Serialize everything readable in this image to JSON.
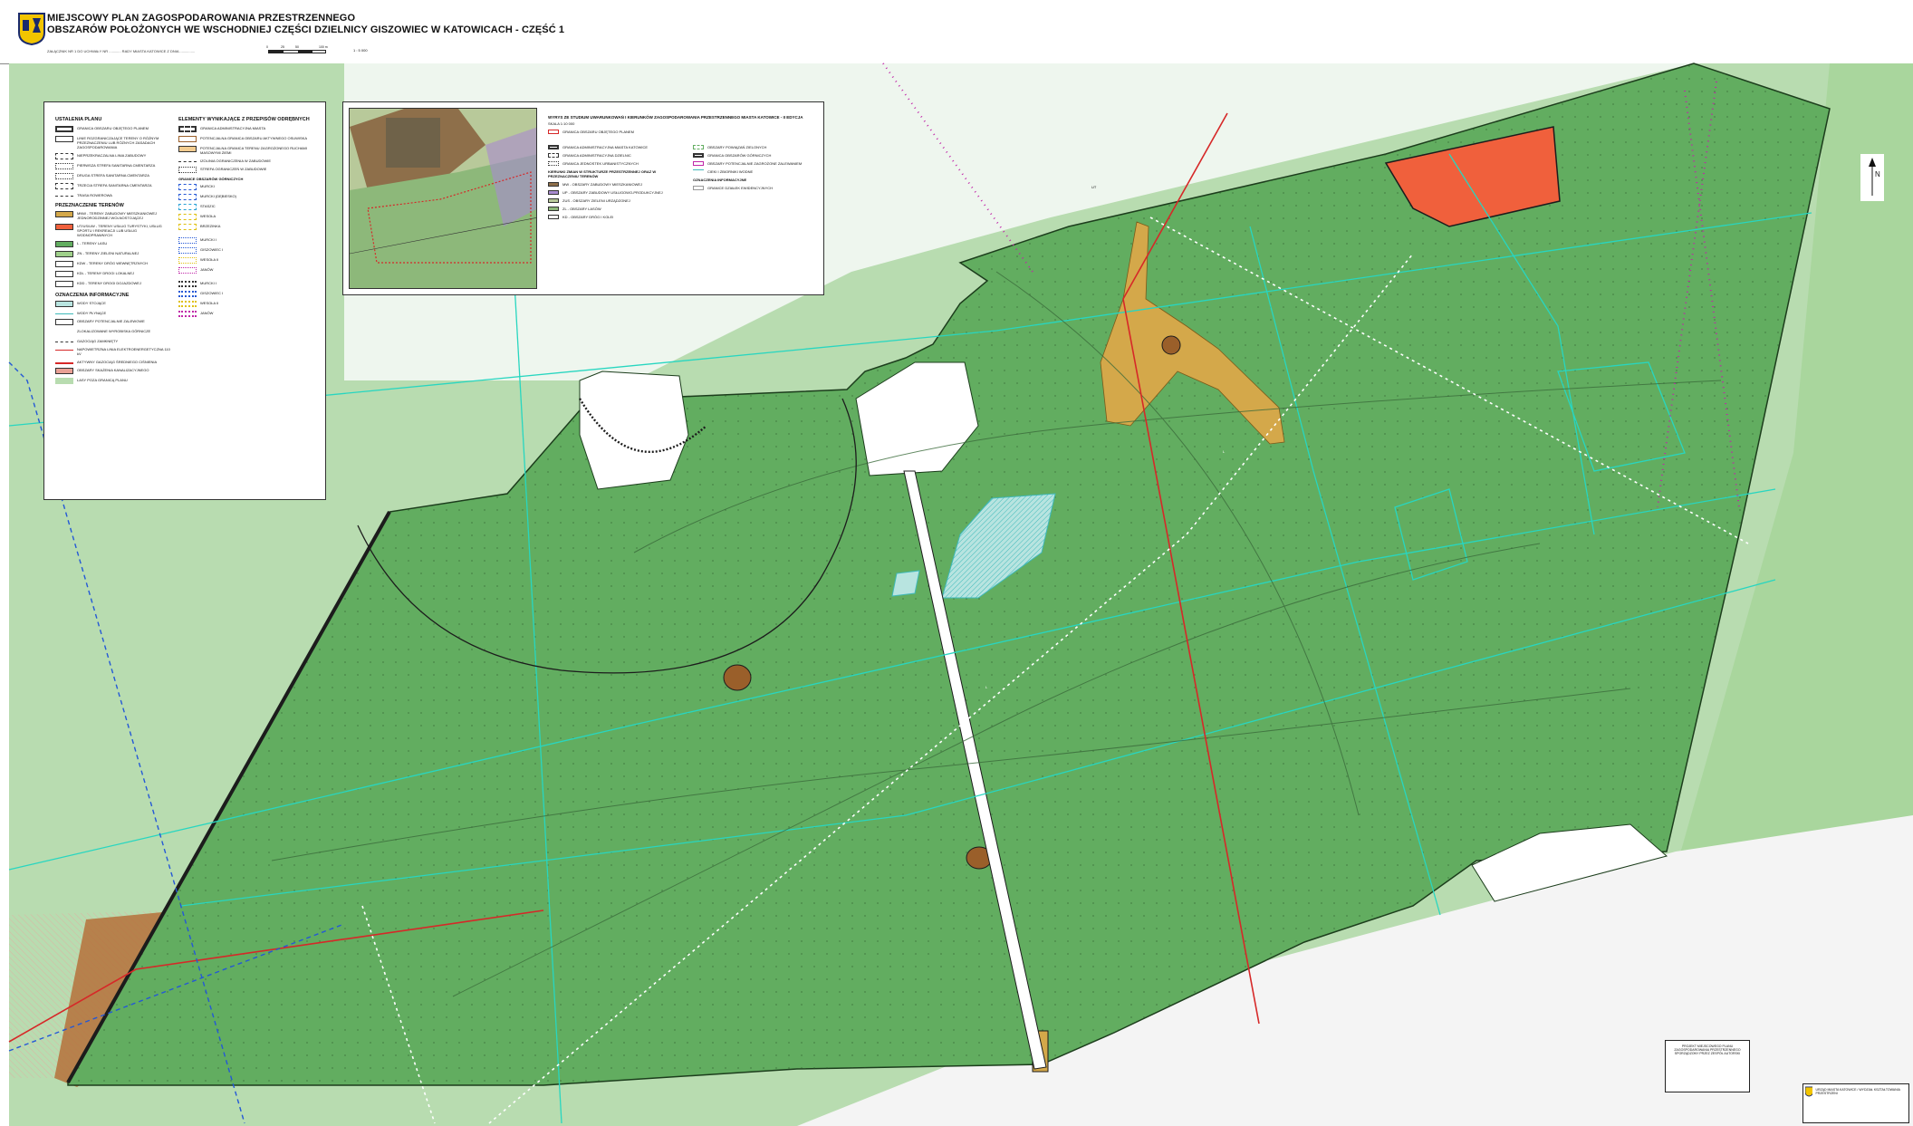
{
  "header": {
    "title_line1": "MIEJSCOWY PLAN ZAGOSPODAROWANIA PRZESTRZENNEGO",
    "title_line2": "OBSZARÓW POŁOŻONYCH WE WSCHODNIEJ CZĘŚCI DZIELNICY GISZOWIEC W KATOWICACH - CZĘŚĆ 1",
    "subline": "ZAŁĄCZNIK NR 1 DO UCHWAŁY NR ............ RADY MIASTA KATOWICE Z DNIA ...............",
    "scale_ticks": [
      "0",
      "25",
      "50",
      "100 m"
    ],
    "scale": "1 : 5 000"
  },
  "legend": {
    "section_plan": "USTALENIA PLANU",
    "plan_items": [
      "GRANICA OBSZARU OBJĘTEGO PLANEM",
      "LINIE ROZGRANICZAJĄCE TERENY O RÓŻNYM PRZEZNACZENIU LUB RÓŻNYCH ZASADACH ZAGOSPODAROWANIA",
      "NIEPRZEKRACZALNA LINIA ZABUDOWY",
      "PIERWSZA STREFA SANITARNA CMENTARZA",
      "DRUGA STREFA SANITARNA CMENTARZA",
      "TRZECIA STREFA SANITARNA CMENTARZA",
      "TRASA ROWEROWA"
    ],
    "section_uses": "PRZEZNACZENIE TERENÓW",
    "use_items": [
      {
        "label": "MNW - TERENY ZABUDOWY MIESZKANIOWEJ JEDNORODZINNEJ WOLNOSTOJĄCEJ",
        "color": "#d4a84a"
      },
      {
        "label": "UT/US/UW - TERENY USŁUG TURYSTYKI, USŁUG SPORTU I REKREACJI LUB USŁUG WODNOPRAWNYCH",
        "color": "#f0603c"
      },
      {
        "label": "L - TERENY LASU",
        "color": "#62ad60"
      },
      {
        "label": "ZN - TERENY ZIELENI NATURALNEJ",
        "color": "#9fd08a"
      },
      {
        "label": "KDW - TERENY DRÓG WEWNĘTRZNYCH",
        "color": "#ffffff"
      },
      {
        "label": "KDL - TERENY DROGI LOKALNEJ",
        "color": "#ffffff"
      },
      {
        "label": "KDD - TERENY DROGI DOJAZDOWEJ",
        "color": "#ffffff"
      }
    ],
    "section_info": "OZNACZENIA INFORMACYJNE",
    "info_items": [
      "WODY STOJĄCE",
      "WODY PŁYNĄCE",
      "OBSZARY POTENCJALNIE ZALEWOWE",
      "ZLOKALIZOWANE WYROBISKA GÓRNICZE",
      "GAZOCIĄG ZAMKNIĘTY",
      "NAPOWIETRZNA LINIA ELEKTROENERGETYCZNA 110 kV",
      "AKTYWNY GAZOCIĄG ŚREDNIEGO CIŚNIENIA",
      "OBSZARY SKAŻENIA KANALIZACYJNEGO",
      "LASY POZA GRANICĄ PLANU"
    ],
    "section_elements": "ELEMENTY WYNIKAJĄCE Z PRZEPISÓW ODRĘBNYCH",
    "element_items": [
      "GRANICA ADMINISTRACYJNA MIASTA",
      "POTENCJALNA GRANICA OBSZARU AKTYWNEGO OSUWISKA",
      "POTENCJALNA GRANICA TERENU ZAGROŻONEGO RUCHAMI MASOWYMI ZIEMI",
      "IZOLINIA OGRANICZENIA W ZABUDOWIE",
      "STREFA OGRANICZEŃ W ZABUDOWIE",
      "GRANICE OBSZARÓW GÓRNICZYCH"
    ],
    "mining_areas": [
      "MURCKI",
      "MURCKI (DĘBIESKO)",
      "STASZIC",
      "WESOŁA",
      "BRZEZINKA"
    ],
    "mining_grounds": [
      "MURCKI I",
      "GISZOWIEC I",
      "WESOŁA II",
      "JANÓW"
    ],
    "terrain_grounds": [
      "MURCKI I",
      "GISZOWIEC I",
      "WESOŁA II",
      "JANÓW"
    ],
    "colors": {
      "forest": "#62ad60",
      "residential": "#d4a84a",
      "tourism": "#f0603c",
      "natural": "#9fd08a",
      "water": "#7dd3d3",
      "cyan_lines": "#28d6c0"
    }
  },
  "study": {
    "title": "WYRYS ZE STUDIUM UWARUNKOWAŃ I KIERUNKÓW ZAGOSPODAROWANIA PRZESTRZENNEGO MIASTA KATOWICE - II EDYCJA",
    "scale": "SKALA 1:10 000",
    "border_label": "GRANICA OBSZARU OBJĘTEGO PLANEM",
    "items_left": [
      "GRANICA ADMINISTRACYJNA MIASTA KATOWICE",
      "GRANICA ADMINISTRACYJNA DZIELNIC",
      "GRANICA JEDNOSTEK URBANISTYCZNYCH",
      "KIERUNKI ZMIAN W STRUKTURZE PRZESTRZENNEJ ORAZ W PRZEZNACZENIU TERENÓW",
      "MW - OBSZARY ZABUDOWY MIESZKANIOWEJ",
      "UP - OBSZARY ZABUDOWY USŁUGOWO-PRODUKCYJNEJ",
      "ZUS - OBSZARY ZIELENI URZĄDZONEJ",
      "ZL - OBSZARY LASÓW",
      "KD - OBSZARY DRÓG I KOLEI"
    ],
    "items_right": [
      "OBSZARY POWIĄZAŃ ZIELONYCH",
      "GRANICA OBSZARÓW GÓRNICZYCH",
      "OBSZARY POTENCJALNIE ZAGROŻONE ZALEWANIEM",
      "CIEKI I ZBIORNIKI WODNE",
      "OZNACZENIA INFORMACYJNE",
      "GRANICE DZIAŁEK EWIDENCYJNYCH"
    ]
  },
  "north": "N",
  "stamp": "PROJEKT MIEJSCOWEGO PLANU ZAGOSPODAROWANIA PRZESTRZENNEGO SPORZĄDZONY PRZEZ ZESPÓŁ AUTORSKI",
  "titleblock": "URZĄD MIASTA KATOWICE / WYDZIAŁ KSZTAŁTOWANIA PRZESTRZENI"
}
